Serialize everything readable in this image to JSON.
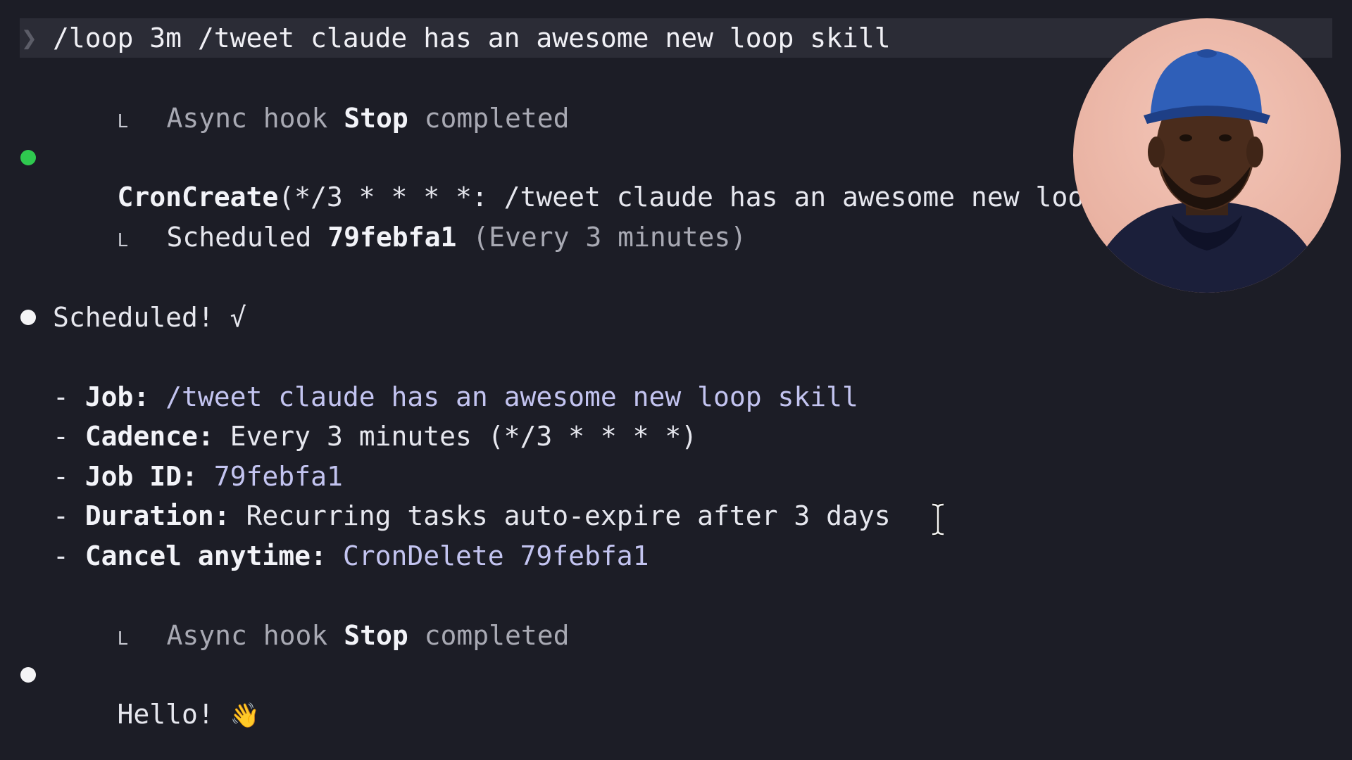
{
  "prompt": {
    "chevron": "❯",
    "command": "/loop 3m /tweet claude has an awesome new loop skill"
  },
  "hook1": {
    "elbow": "L",
    "prefix": "Async hook ",
    "name": "Stop",
    "suffix": " completed"
  },
  "cron_call": {
    "tool": "CronCreate",
    "args": "(*/3 * * * *: /tweet claude has an awesome new loop s",
    "result_prefix": "Scheduled ",
    "job_id": "79febfa1",
    "result_suffix": " (Every 3 minutes)"
  },
  "scheduled": {
    "title": "Scheduled! √"
  },
  "details": [
    {
      "label": "Job:",
      "value": " /tweet claude has an awesome new loop skill",
      "value_style": "lav"
    },
    {
      "label": "Cadence:",
      "value": " Every 3 minutes (*/3 * * * *)",
      "value_style": "plain"
    },
    {
      "label": "Job ID:",
      "value": " 79febfa1",
      "value_style": "lav"
    },
    {
      "label": "Duration:",
      "value": " Recurring tasks auto-expire after 3 days",
      "value_style": "plain"
    },
    {
      "label": "Cancel anytime:",
      "value": " CronDelete 79febfa1",
      "value_style": "lav"
    }
  ],
  "hook2": {
    "elbow": "L",
    "prefix": "Async hook ",
    "name": "Stop",
    "suffix": " completed"
  },
  "hello": {
    "text": "Hello! ",
    "emoji": "👋"
  },
  "colors": {
    "background": "#1c1d26",
    "accent_green": "#2fc94f",
    "lavender": "#c3c4f0"
  }
}
